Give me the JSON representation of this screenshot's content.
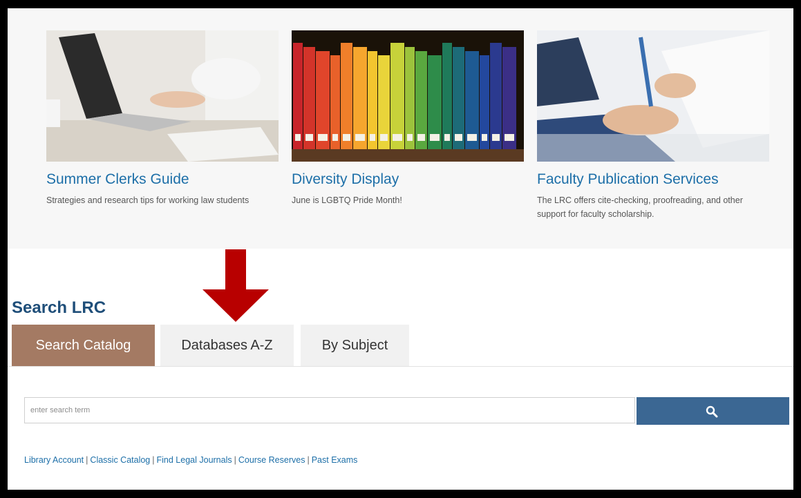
{
  "featured": [
    {
      "title": "Summer Clerks Guide",
      "description": "Strategies and research tips for working law students",
      "image_icon": "laptop-typing-photo"
    },
    {
      "title": "Diversity Display",
      "description": "June is LGBTQ Pride Month!",
      "image_icon": "rainbow-books-photo"
    },
    {
      "title": "Faculty Publication Services",
      "description": "The LRC offers cite-checking, proofreading, and other support for faculty scholarship.",
      "image_icon": "document-review-photo"
    }
  ],
  "annotation": {
    "icon": "down-arrow",
    "color": "#b80000"
  },
  "search": {
    "heading": "Search LRC",
    "tabs": [
      {
        "label": "Search Catalog",
        "active": true
      },
      {
        "label": "Databases A-Z",
        "active": false
      },
      {
        "label": "By Subject",
        "active": false
      }
    ],
    "placeholder": "enter search term",
    "button_icon": "search-icon"
  },
  "quick_links": [
    "Library Account",
    "Classic Catalog",
    "Find Legal Journals",
    "Course Reserves",
    "Past Exams"
  ],
  "colors": {
    "link": "#1d6fa8",
    "active_tab": "#a47a63",
    "search_button": "#3b6793",
    "heading": "#1f4e79"
  }
}
